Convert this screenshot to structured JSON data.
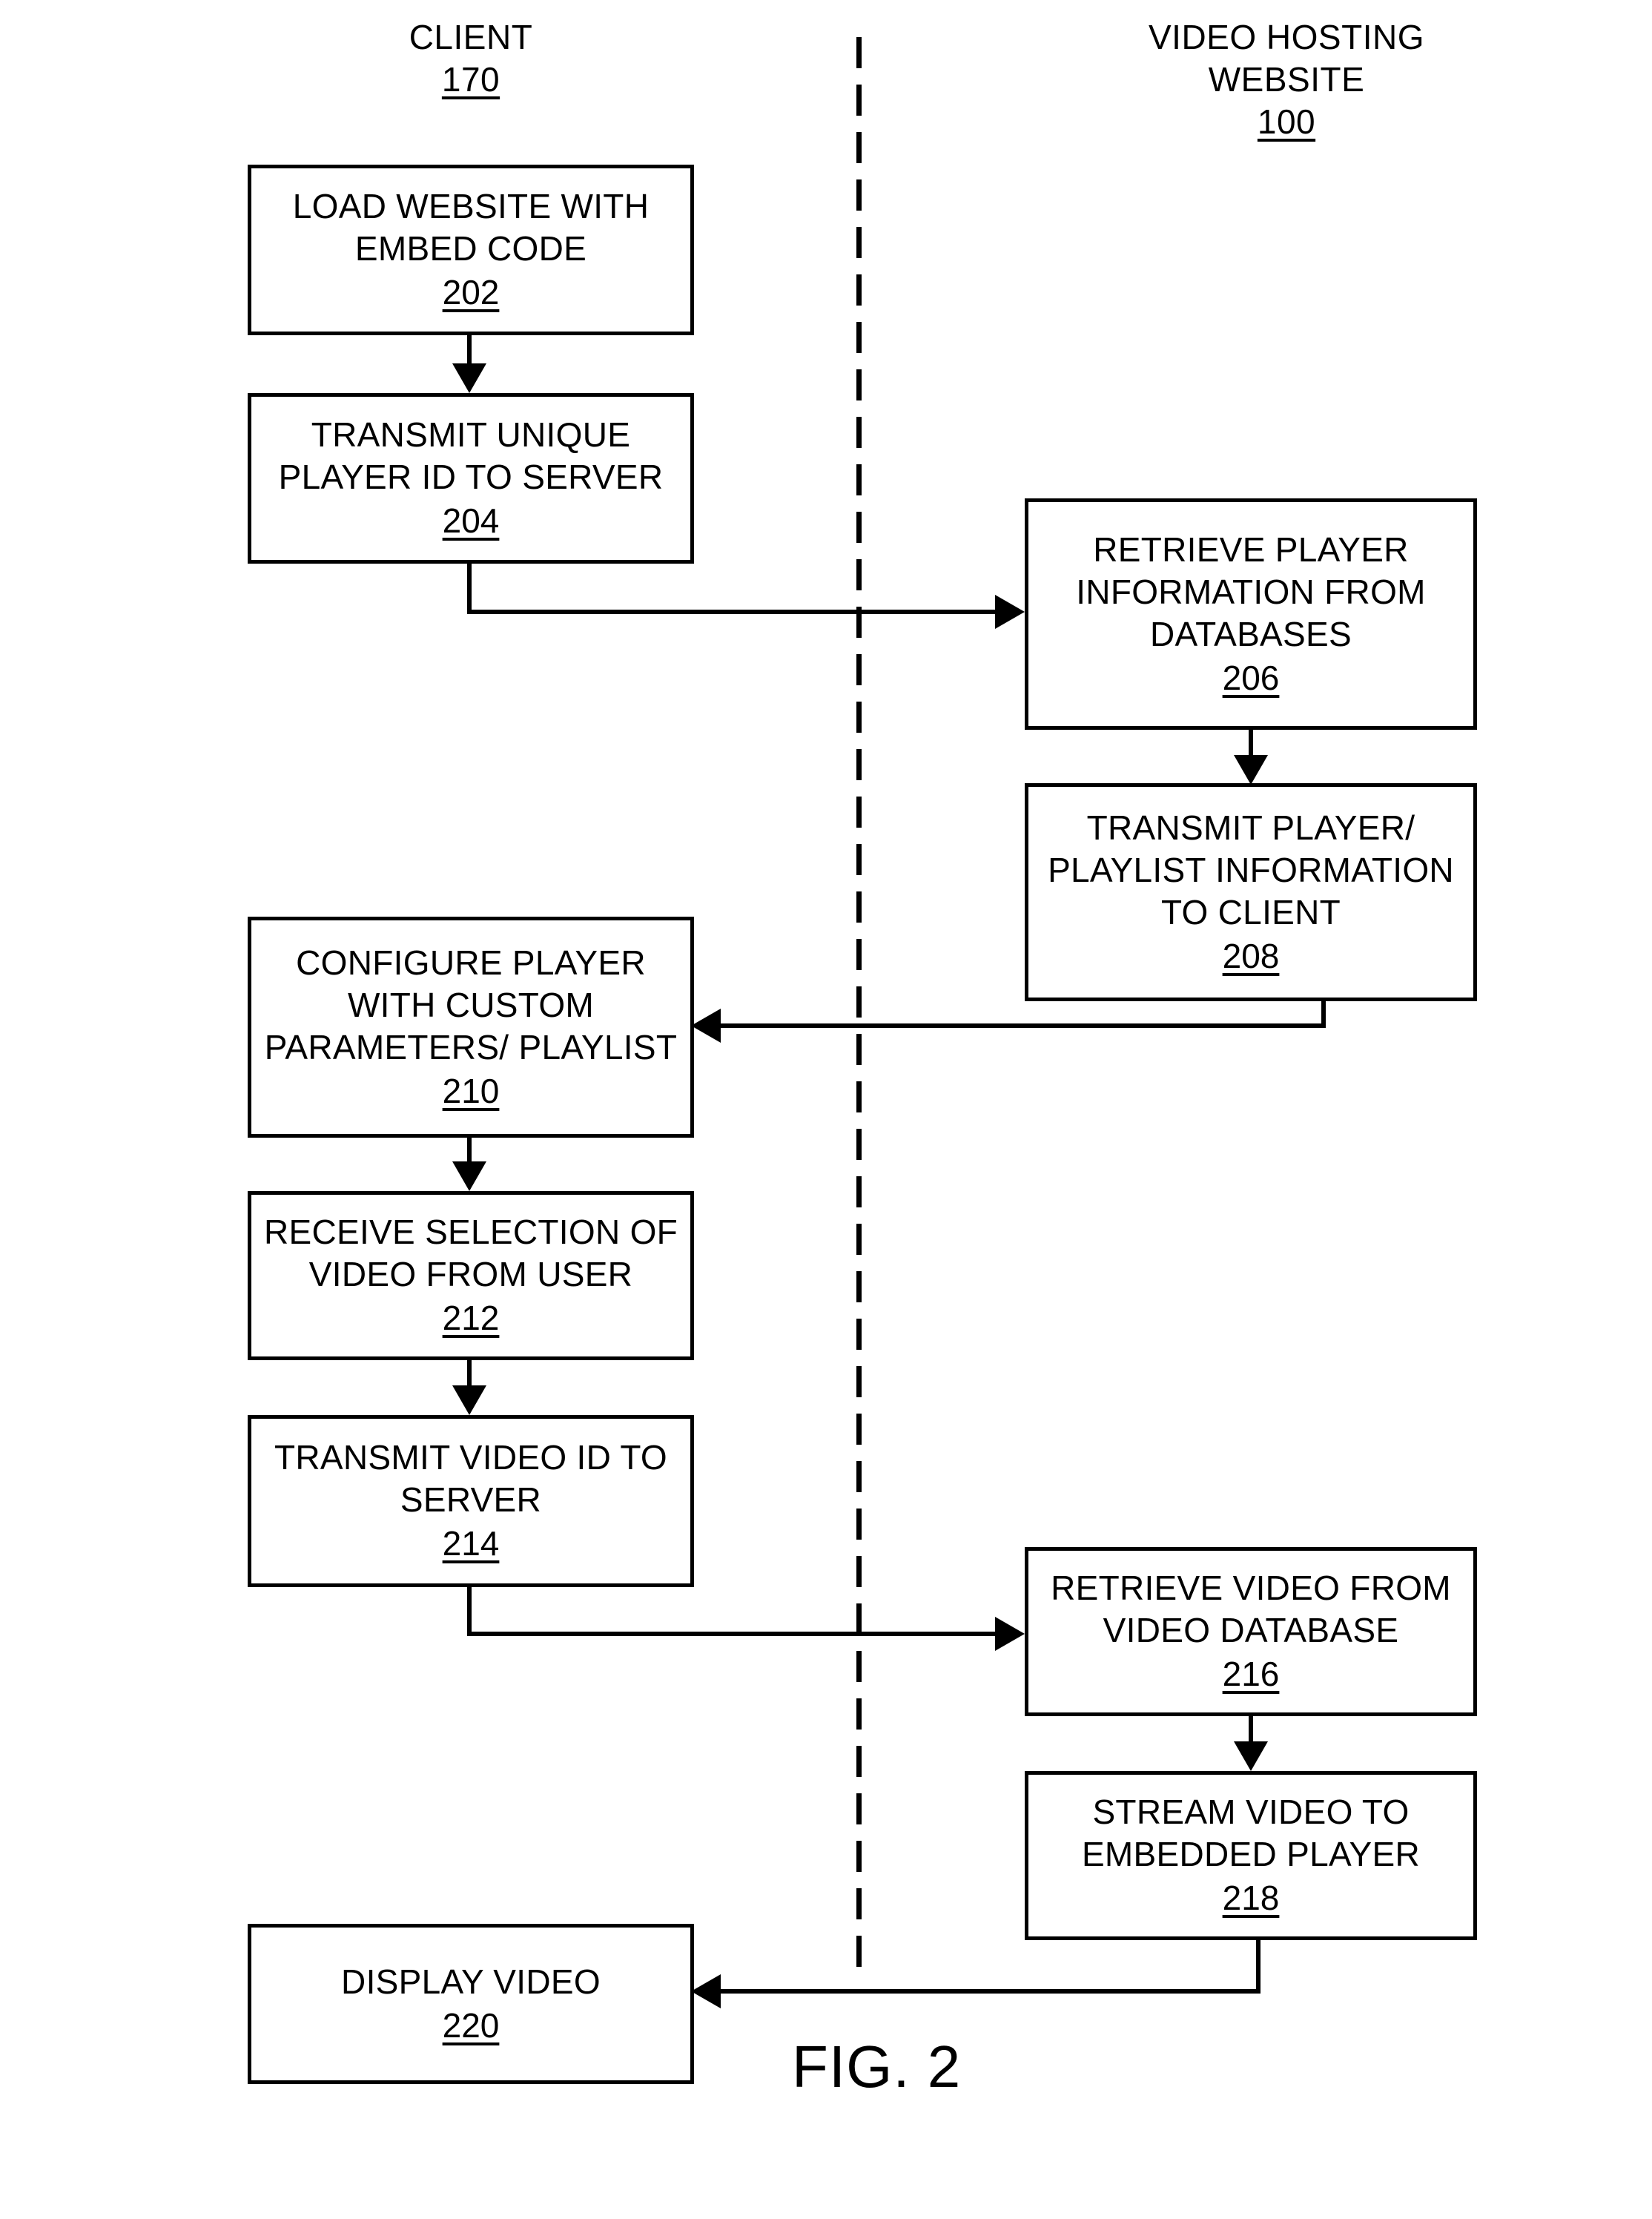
{
  "figure": {
    "caption": "FIG. 2",
    "lanes": [
      {
        "title": "CLIENT",
        "ref": "170"
      },
      {
        "title": "VIDEO HOSTING WEBSITE",
        "title_line1": "VIDEO HOSTING",
        "title_line2": "WEBSITE",
        "ref": "100"
      }
    ]
  },
  "nodes": [
    {
      "id": "202",
      "lane": "client",
      "ref": "202",
      "line1": "LOAD WEBSITE WITH",
      "line2": "EMBED CODE",
      "line3": ""
    },
    {
      "id": "204",
      "lane": "client",
      "ref": "204",
      "line1": "TRANSMIT UNIQUE",
      "line2": "PLAYER ID TO SERVER",
      "line3": ""
    },
    {
      "id": "206",
      "lane": "server",
      "ref": "206",
      "line1": "RETRIEVE PLAYER",
      "line2": "INFORMATION FROM",
      "line3": "DATABASES"
    },
    {
      "id": "208",
      "lane": "server",
      "ref": "208",
      "line1": "TRANSMIT PLAYER/",
      "line2": "PLAYLIST INFORMATION",
      "line3": "TO CLIENT"
    },
    {
      "id": "210",
      "lane": "client",
      "ref": "210",
      "line1": "CONFIGURE PLAYER",
      "line2": "WITH CUSTOM",
      "line3": "PARAMETERS/ PLAYLIST"
    },
    {
      "id": "212",
      "lane": "client",
      "ref": "212",
      "line1": "RECEIVE SELECTION OF",
      "line2": "VIDEO FROM USER",
      "line3": ""
    },
    {
      "id": "214",
      "lane": "client",
      "ref": "214",
      "line1": "TRANSMIT VIDEO ID TO",
      "line2": "SERVER",
      "line3": ""
    },
    {
      "id": "216",
      "lane": "server",
      "ref": "216",
      "line1": "RETRIEVE VIDEO FROM",
      "line2": "VIDEO DATABASE",
      "line3": ""
    },
    {
      "id": "218",
      "lane": "server",
      "ref": "218",
      "line1": "STREAM VIDEO TO",
      "line2": "EMBEDDED PLAYER",
      "line3": ""
    },
    {
      "id": "220",
      "lane": "client",
      "ref": "220",
      "line1": "DISPLAY VIDEO",
      "line2": "",
      "line3": ""
    }
  ],
  "edges": [
    {
      "from": "202",
      "to": "204",
      "kind": "down"
    },
    {
      "from": "204",
      "to": "206",
      "kind": "cross-right"
    },
    {
      "from": "206",
      "to": "208",
      "kind": "down"
    },
    {
      "from": "208",
      "to": "210",
      "kind": "cross-left"
    },
    {
      "from": "210",
      "to": "212",
      "kind": "down"
    },
    {
      "from": "212",
      "to": "214",
      "kind": "down"
    },
    {
      "from": "214",
      "to": "216",
      "kind": "cross-right"
    },
    {
      "from": "216",
      "to": "218",
      "kind": "down"
    },
    {
      "from": "218",
      "to": "220",
      "kind": "cross-left"
    }
  ],
  "colors": {
    "ink": "#000000",
    "paper": "#ffffff"
  }
}
